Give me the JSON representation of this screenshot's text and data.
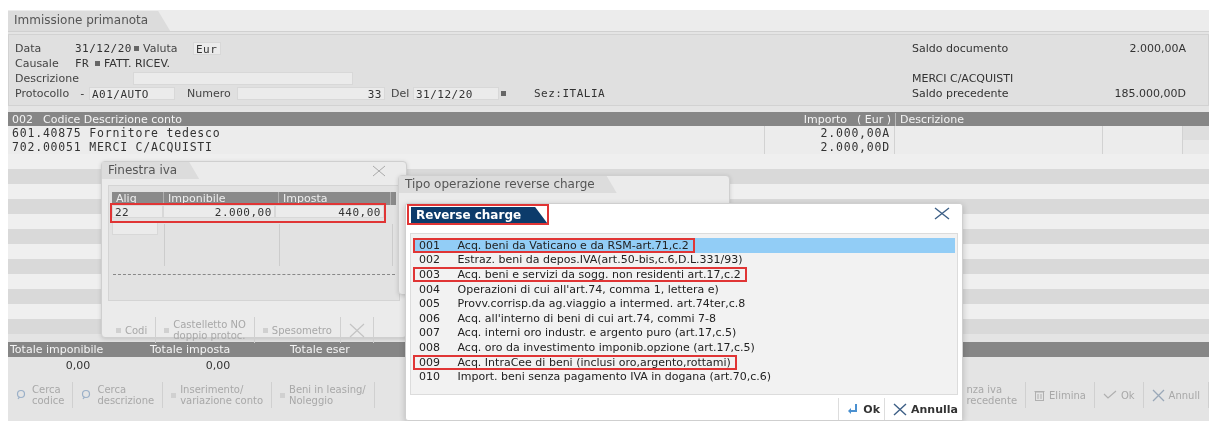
{
  "title": "Immissione primanota",
  "header": {
    "data": {
      "label": "Data",
      "value": "31/12/20"
    },
    "valuta": {
      "label": "Valuta",
      "value": "Eur"
    },
    "causale": {
      "label": "Causale",
      "code": "FR",
      "value": "FATT. RICEV."
    },
    "descrizione": {
      "label": "Descrizione"
    },
    "protocollo": {
      "label": "Protocollo",
      "prefix": "-",
      "value": "A01/AUTO"
    },
    "numero": {
      "label": "Numero",
      "value": "33"
    },
    "del": {
      "label": "Del",
      "value": "31/12/20"
    },
    "sezione": "Sez:ITALIA",
    "saldo_documento": {
      "label": "Saldo documento",
      "value": "2.000,00A"
    },
    "conto": "MERCI C/ACQUISTI",
    "saldo_precedente": {
      "label": "Saldo precedente",
      "value": "185.000,00D"
    }
  },
  "grid": {
    "columns": [
      "002",
      "Codice Descrizione conto",
      "Importo",
      "( Eur )",
      "Descrizione"
    ],
    "rows": [
      {
        "account": "601.40875 Fornitore tedesco",
        "amount": "2.000,00A"
      },
      {
        "account": "702.00051 MERCI C/ACQUISTI",
        "amount": "2.000,00D"
      }
    ]
  },
  "totals": [
    {
      "label": "Totale imponibile",
      "value": "0,00"
    },
    {
      "label": "Totale imposta",
      "value": "0,00"
    },
    {
      "label": "Totale eser"
    }
  ],
  "toolbar": {
    "left": [
      {
        "kind": "search",
        "lines": [
          "Cerca",
          "codice"
        ],
        "disabled": true
      },
      {
        "kind": "search",
        "lines": [
          "Cerca",
          "descrizione"
        ],
        "disabled": true
      },
      {
        "kind": "plain",
        "lines": [
          "Inserimento/",
          "variazione conto"
        ],
        "disabled": true
      },
      {
        "kind": "plain",
        "lines": [
          "Beni in leasing/",
          "Noleggio"
        ],
        "disabled": true
      }
    ],
    "right": [
      {
        "kind": "cut",
        "lines": [
          "nza iva",
          "recedente"
        ],
        "disabled": true
      },
      {
        "kind": "delete",
        "lines": [
          "Elimina"
        ],
        "disabled": true
      },
      {
        "kind": "confirm",
        "lines": [
          "Ok"
        ],
        "disabled": true
      },
      {
        "kind": "cancel",
        "lines": [
          "Annull"
        ],
        "disabled": true
      }
    ]
  },
  "iva_window": {
    "title": "Finestra iva",
    "columns": [
      "Aliq",
      "Imponibile",
      "Imposta"
    ],
    "rows": [
      {
        "aliq": "22",
        "imponibile": "2.000,00",
        "imposta": "440,00",
        "highlighted": true
      }
    ],
    "buttons": [
      {
        "kind": "plain",
        "lines": [
          "Codi"
        ],
        "disabled": true
      },
      {
        "kind": "plain",
        "lines": [
          "Castelletto NO",
          "doppio protoc."
        ],
        "disabled": true
      },
      {
        "kind": "plain",
        "lines": [
          "Spesometro"
        ],
        "disabled": true
      },
      {
        "kind": "close",
        "disabled": true
      }
    ]
  },
  "reverse_window": {
    "title": "Tipo operazione reverse charge"
  },
  "reverse_dialog": {
    "title": "Reverse charge",
    "title_highlighted": true,
    "items": [
      {
        "code": "001",
        "text": "Acq. beni da Vaticano e da RSM-art.71,c.2",
        "selected": true,
        "highlighted": true
      },
      {
        "code": "002",
        "text": "Estraz. beni da depos.IVA(art.50-bis,c.6,D.L.331/93)",
        "selected": false,
        "highlighted": false
      },
      {
        "code": "003",
        "text": "Acq. beni e servizi da sogg. non residenti art.17,c.2",
        "selected": false,
        "highlighted": true
      },
      {
        "code": "004",
        "text": "Operazioni di cui all'art.74, comma 1, lettera e)",
        "selected": false,
        "highlighted": false
      },
      {
        "code": "005",
        "text": "Provv.corrisp.da ag.viaggio a intermed. art.74ter,c.8",
        "selected": false,
        "highlighted": false
      },
      {
        "code": "006",
        "text": "Acq. all'interno di beni di cui art.74, commi 7-8",
        "selected": false,
        "highlighted": false
      },
      {
        "code": "007",
        "text": "Acq. interni oro industr. e argento puro (art.17,c.5)",
        "selected": false,
        "highlighted": false
      },
      {
        "code": "008",
        "text": "Acq. oro da investimento imponib.opzione (art.17,c.5)",
        "selected": false,
        "highlighted": false
      },
      {
        "code": "009",
        "text": "Acq. IntraCee di beni (inclusi oro,argento,rottami)",
        "selected": false,
        "highlighted": true
      },
      {
        "code": "010",
        "text": "Import. beni senza pagamento IVA in dogana (art.70,c.6)",
        "selected": false,
        "highlighted": false
      }
    ],
    "buttons": [
      {
        "kind": "ok",
        "label": "Ok"
      },
      {
        "kind": "cancel",
        "label": "Annulla"
      }
    ]
  }
}
